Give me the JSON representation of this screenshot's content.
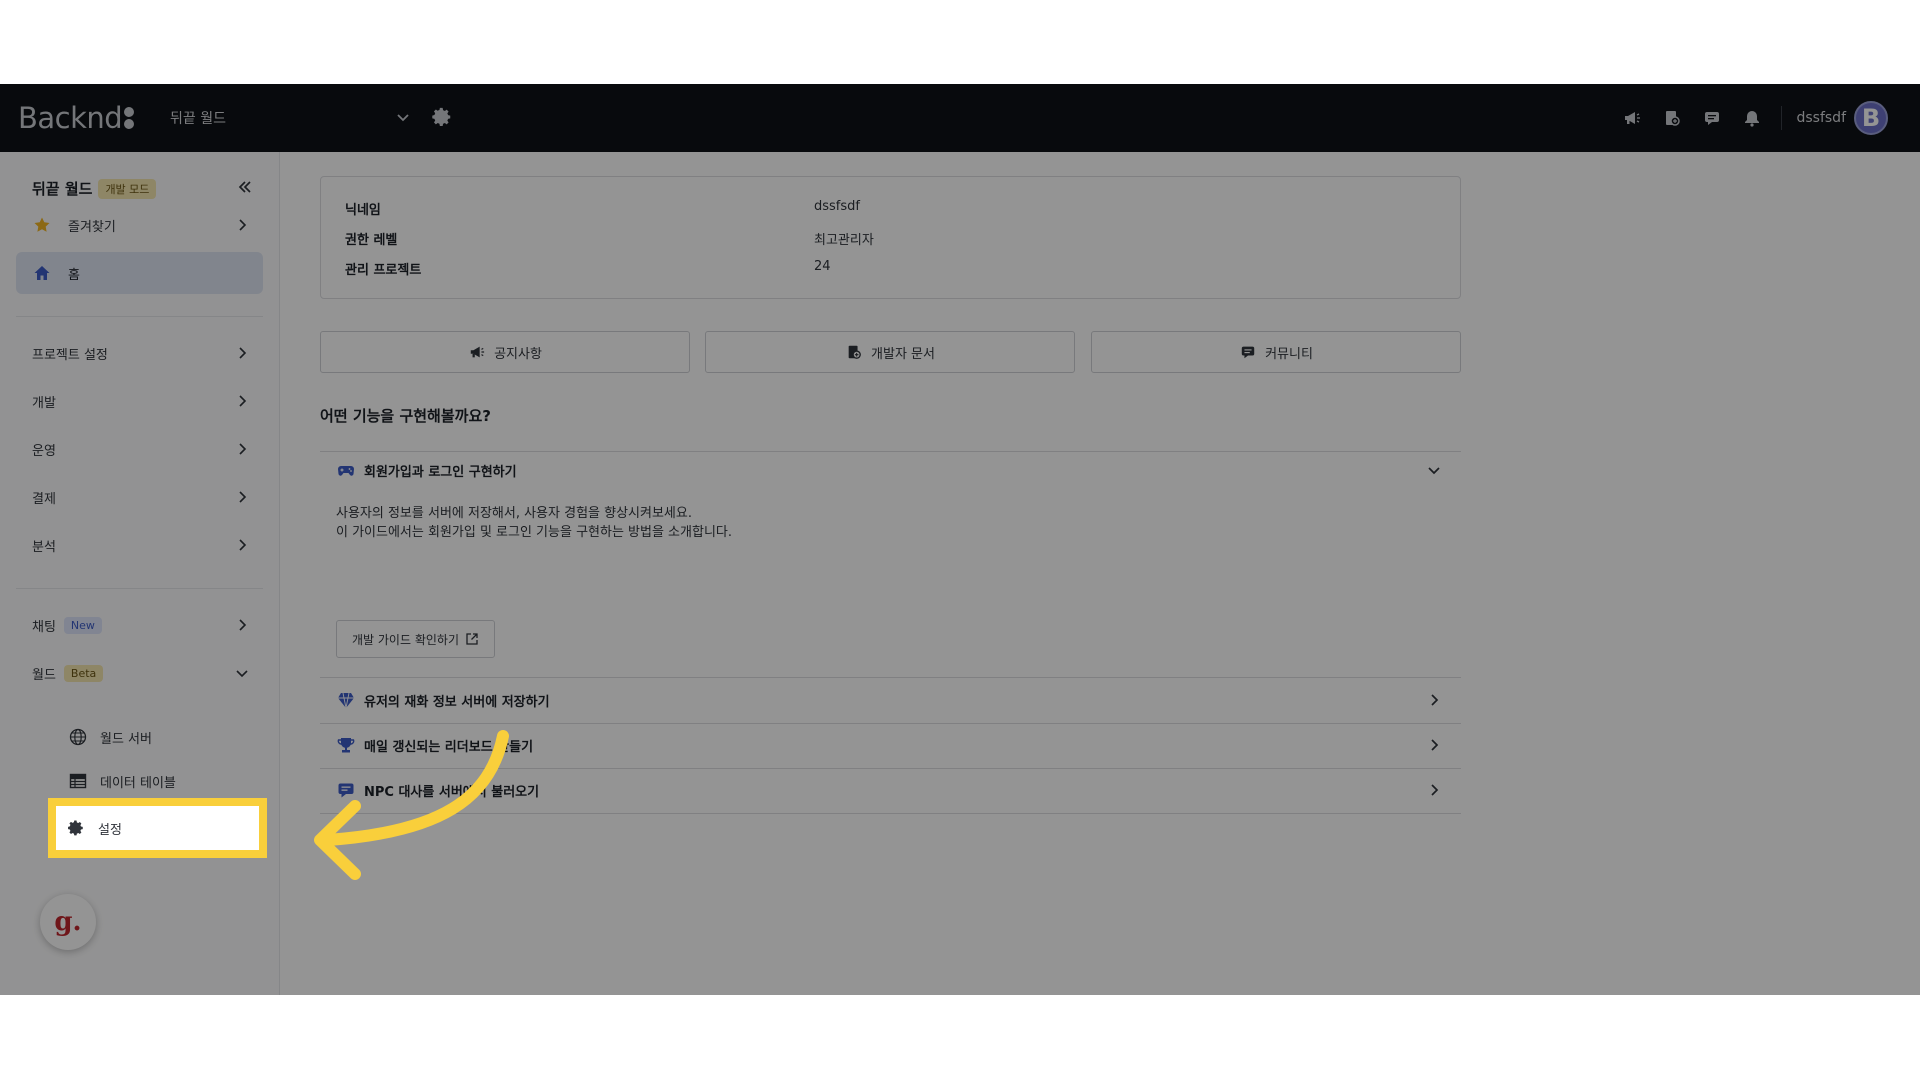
{
  "topbar": {
    "logo_text": "Backnd",
    "project_name": "뒤끝 월드",
    "username": "dssfsdf",
    "avatar_letter": "B",
    "icons": [
      "megaphone-icon",
      "docs-icon",
      "chat-icon",
      "bell-icon"
    ]
  },
  "sidebar": {
    "title": "뒤끝 월드",
    "mode_badge": "개발 모드",
    "items": {
      "favorites": "즐겨찾기",
      "home": "홈",
      "project_settings": "프로젝트 설정",
      "development": "개발",
      "operation": "운영",
      "payment": "결제",
      "analytics": "분석",
      "chatting": "채팅",
      "chatting_badge": "New",
      "world": "월드",
      "world_badge": "Beta",
      "world_server": "월드 서버",
      "data_table": "데이터 테이블",
      "settings": "설정"
    },
    "g_label": "g."
  },
  "info": {
    "rows": [
      {
        "key": "닉네임",
        "value": "dssfsdf"
      },
      {
        "key": "권한 레벨",
        "value": "최고관리자"
      },
      {
        "key": "관리 프로젝트",
        "value": "24"
      }
    ]
  },
  "links": {
    "notice": "공지사항",
    "dev_docs": "개발자 문서",
    "community": "커뮤니티"
  },
  "features": {
    "title": "어떤 기능을 구현해볼까요?",
    "items": [
      {
        "title": "회원가입과 로그인 구현하기",
        "expanded": true
      },
      {
        "title": "유저의 재화 정보 서버에 저장하기"
      },
      {
        "title": "매일 갱신되는 리더보드 만들기"
      },
      {
        "title": "NPC 대사를 서버에서 불러오기"
      }
    ],
    "desc_line1": "사용자의 정보를 서버에 저장해서, 사용자 경험을 향상시켜보세요.",
    "desc_line2": "이 가이드에서는 회원가입 및 로그인 기능을 구현하는 방법을 소개합니다.",
    "guide_button": "개발 가이드 확인하기"
  },
  "colors": {
    "highlight": "#f9cf3b",
    "topbar": "#0e1218",
    "active_item": "#dfe5f3",
    "accent_blue": "#3d5cc7"
  }
}
